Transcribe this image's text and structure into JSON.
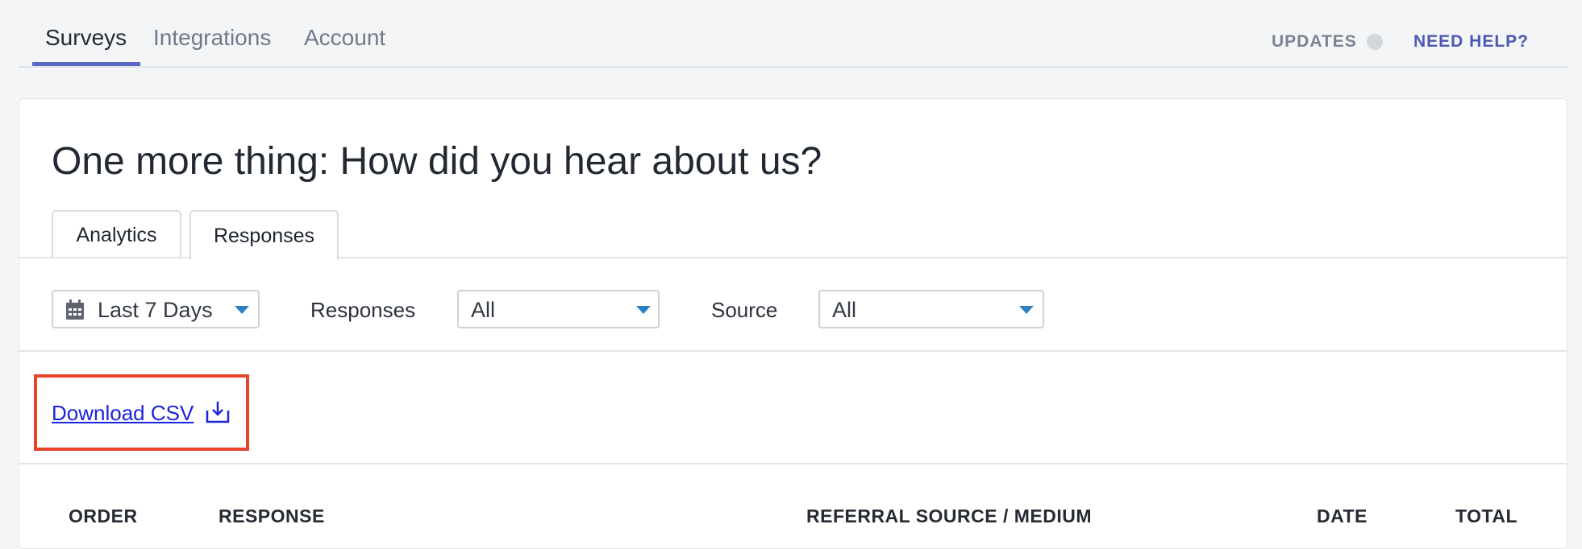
{
  "nav": {
    "tabs": [
      {
        "label": "Surveys",
        "active": true
      },
      {
        "label": "Integrations",
        "active": false
      },
      {
        "label": "Account",
        "active": false
      }
    ],
    "updates_label": "UPDATES",
    "help_label": "NEED HELP?"
  },
  "survey": {
    "title": "One more thing: How did you hear about us?",
    "tabs": [
      {
        "label": "Analytics",
        "selected": false
      },
      {
        "label": "Responses",
        "selected": true
      }
    ]
  },
  "filters": {
    "date_range": {
      "value": "Last 7 Days",
      "icon": "calendar-icon"
    },
    "responses": {
      "label": "Responses",
      "value": "All"
    },
    "source": {
      "label": "Source",
      "value": "All"
    }
  },
  "download": {
    "label": "Download CSV",
    "icon": "download-icon"
  },
  "table": {
    "columns": [
      "ORDER",
      "RESPONSE",
      "REFERRAL SOURCE / MEDIUM",
      "DATE",
      "TOTAL"
    ]
  },
  "colors": {
    "accent": "#5b67c4",
    "link": "#1a24d8",
    "highlight": "#e6432a",
    "caret": "#2c7fc0"
  }
}
